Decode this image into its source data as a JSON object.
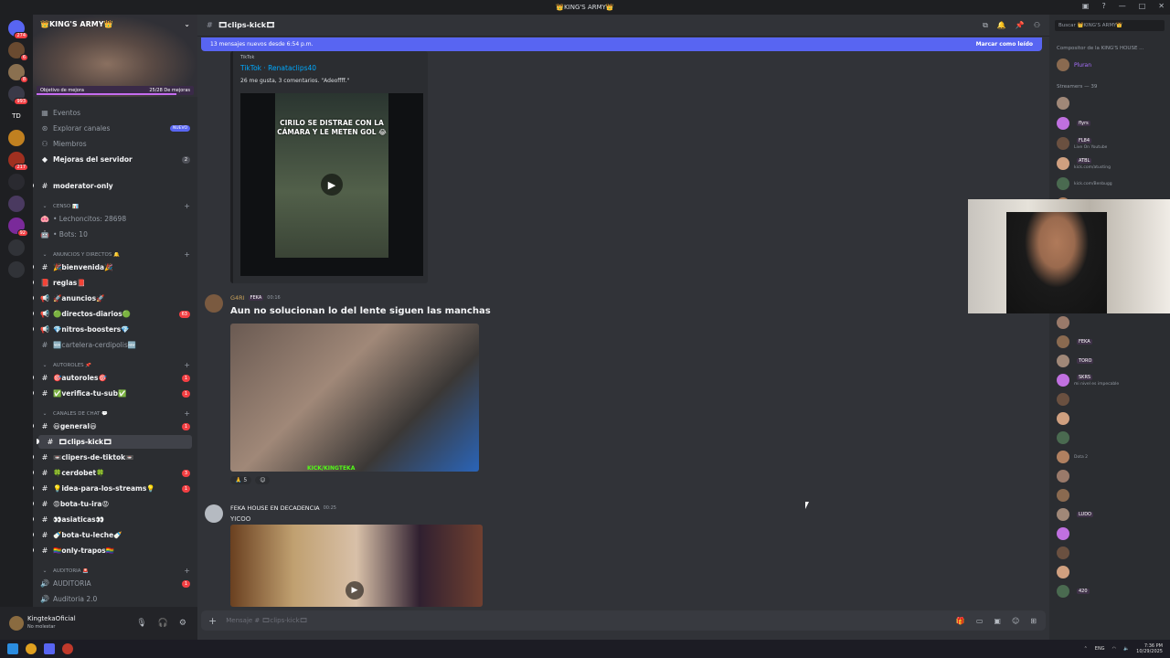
{
  "window": {
    "title": "👑KING'S ARMY👑"
  },
  "guilds": [
    {
      "icon": "discord-icon",
      "badge": "274"
    },
    {
      "icon": "avatar",
      "badge": "6"
    },
    {
      "icon": "avatar",
      "badge": "8"
    },
    {
      "icon": "avatar",
      "badge": "993"
    },
    {
      "icon": "td-icon",
      "label": "TD"
    },
    {
      "icon": "avatar",
      "badge": ""
    },
    {
      "icon": "avatar",
      "badge": "217"
    },
    {
      "icon": "avatar",
      "badge": ""
    },
    {
      "icon": "avatar",
      "badge": ""
    },
    {
      "icon": "avatar",
      "badge": "92"
    },
    {
      "icon": "add-server-icon"
    },
    {
      "icon": "explore-icon"
    }
  ],
  "server": {
    "name": "👑KING'S ARMY👑",
    "boost_goal": "Objetivo de mejora",
    "boost_progress": "25/28 De mejoras",
    "boost_fraction": 0.89
  },
  "nav": {
    "events": "Eventos",
    "explore": "Explorar canales",
    "explore_badge": "NUEVO",
    "members": "Miembros",
    "boosts": "Mejoras del servidor",
    "boosts_count": "2"
  },
  "channels": [
    {
      "icon": "#",
      "label": "moderator-only",
      "bright": true
    },
    {
      "cat": true,
      "label": "CENSO 📊"
    },
    {
      "icon": "🐽",
      "label": "• Lechoncitos: 28698"
    },
    {
      "icon": "🤖",
      "label": "• Bots: 10"
    },
    {
      "cat": true,
      "label": "ANUNCIOS Y DIRECTOS 🔔"
    },
    {
      "icon": "#",
      "label": "🎉bienvenida🎉",
      "bright": true
    },
    {
      "icon": "📕",
      "label": "reglas📕",
      "bright": true
    },
    {
      "icon": "📢",
      "label": "🚀anuncios🚀",
      "bright": true
    },
    {
      "icon": "📢",
      "label": "🟢directos-diarios🟢",
      "bright": true,
      "badge": "63"
    },
    {
      "icon": "📢",
      "label": "💎nitros-boosters💎",
      "bright": true
    },
    {
      "icon": "#",
      "label": "🆕cartelera-cerdipolis🆕"
    },
    {
      "cat": true,
      "label": "AUTOROLES 📌"
    },
    {
      "icon": "#",
      "label": "🎯autoroles🎯",
      "bright": true,
      "badge": "1"
    },
    {
      "icon": "#",
      "label": "✅verifica-tu-sub✅",
      "bright": true,
      "badge": "1"
    },
    {
      "cat": true,
      "label": "CANALES DE CHAT 💬"
    },
    {
      "icon": "#",
      "label": "😃general😃",
      "bright": true,
      "badge": "1"
    },
    {
      "icon": "#",
      "label": "🎞clips-kick🎞",
      "bright": true,
      "selected": true
    },
    {
      "icon": "#",
      "label": "📼clipers-de-tiktok📼",
      "bright": true
    },
    {
      "icon": "#",
      "label": "🍀cerdobet🍀",
      "bright": true,
      "badge": "3"
    },
    {
      "icon": "#",
      "label": "💡idea-para-los-streams💡",
      "bright": true,
      "badge": "1"
    },
    {
      "icon": "#",
      "label": "😡bota-tu-ira😡",
      "bright": true
    },
    {
      "icon": "#",
      "label": "👀asiaticas👀",
      "bright": true
    },
    {
      "icon": "#",
      "label": "🍼bota-tu-leche🍼",
      "bright": true
    },
    {
      "icon": "#",
      "label": "🏳️‍🌈only-trapos🏳️‍🌈",
      "bright": true
    },
    {
      "cat": true,
      "label": "AUDITORIA 🚨"
    },
    {
      "icon": "🔊",
      "label": "AUDITORIA",
      "badge": "1"
    },
    {
      "icon": "🔊",
      "label": "Auditoria 2.0"
    }
  ],
  "user": {
    "name": "KingtekaOficial",
    "status": "No molestar"
  },
  "channel": {
    "name": "🎞clips-kick🎞"
  },
  "banner": {
    "text": "13 mensajes nuevos desde 6:54 p.m.",
    "mark_read": "Marcar como leído"
  },
  "embed": {
    "provider": "TikTok",
    "title": "TikTok · Renataclips40",
    "description": "26 me gusta, 3 comentarios. \"Adeoffff.\"",
    "caption": "CIRILO SE DISTRAE CON LA CÁMARA Y LE METEN GOL 😂"
  },
  "messages": [
    {
      "author": "G4RI",
      "tag": "FEKA",
      "time": "00:16",
      "text": "Aun no solucionan lo del lente siguen las manchas",
      "image_text": "KICK/KINGTEKA",
      "reaction_count": "5"
    },
    {
      "author": "FEKA HOUSE EN DECADENCIA",
      "time": "00:25",
      "text": "YICOO"
    }
  ],
  "composer": {
    "placeholder": "Mensaje # 🎞clips-kick🎞"
  },
  "member_list": {
    "search_placeholder": "Buscar 👑KING'S ARMY👑",
    "group1": "Compositor de la KING'S HOUSE ...",
    "group2": "Streamers — 39",
    "members": [
      {
        "name": "Pluran",
        "color": "#a970ff",
        "tag": "",
        "sub": ""
      },
      {
        "name": "",
        "color": "#a970ff",
        "tag": "",
        "sub": ""
      },
      {
        "name": "",
        "color": "#a970ff",
        "tag": "flyrs",
        "sub": ""
      },
      {
        "name": "",
        "color": "#a970ff",
        "tag": "FL84",
        "sub": "Live On Youtube"
      },
      {
        "name": "",
        "color": "#a970ff",
        "tag": "ATBL",
        "sub": "kick.com/atusting"
      },
      {
        "name": "",
        "color": "#a970ff",
        "tag": "",
        "sub": "kick.com/Benbugg"
      },
      {
        "name": "",
        "color": "#a970ff",
        "tag": "",
        "sub": ""
      },
      {
        "name": "",
        "color": "#a970ff",
        "tag": "",
        "sub": ""
      },
      {
        "name": "",
        "color": "#a970ff",
        "tag": "FEKA",
        "sub": ""
      },
      {
        "name": "",
        "color": "#a970ff",
        "tag": "TORO",
        "sub": ""
      },
      {
        "name": "",
        "color": "#a970ff",
        "tag": "SKRS",
        "sub": "mi nivel es impecable"
      },
      {
        "name": "",
        "color": "#a970ff",
        "tag": "",
        "sub": ""
      },
      {
        "name": "",
        "color": "#a970ff",
        "tag": "",
        "sub": ""
      },
      {
        "name": "",
        "color": "#a970ff",
        "tag": "",
        "sub": ""
      },
      {
        "name": "",
        "color": "#a970ff",
        "tag": "",
        "sub": "Dota 2"
      },
      {
        "name": "",
        "color": "#a970ff",
        "tag": "",
        "sub": ""
      },
      {
        "name": "",
        "color": "#a970ff",
        "tag": "",
        "sub": ""
      },
      {
        "name": "",
        "color": "#a970ff",
        "tag": "LUDO",
        "sub": ""
      },
      {
        "name": "",
        "color": "#a970ff",
        "tag": "",
        "sub": ""
      },
      {
        "name": "",
        "color": "#a970ff",
        "tag": "",
        "sub": ""
      },
      {
        "name": "",
        "color": "#a970ff",
        "tag": "",
        "sub": ""
      },
      {
        "name": "",
        "color": "#a970ff",
        "tag": "420",
        "sub": ""
      }
    ]
  },
  "taskbar": {
    "lang": "ENG",
    "time": "7:36 PM",
    "date": "10/29/2025"
  }
}
